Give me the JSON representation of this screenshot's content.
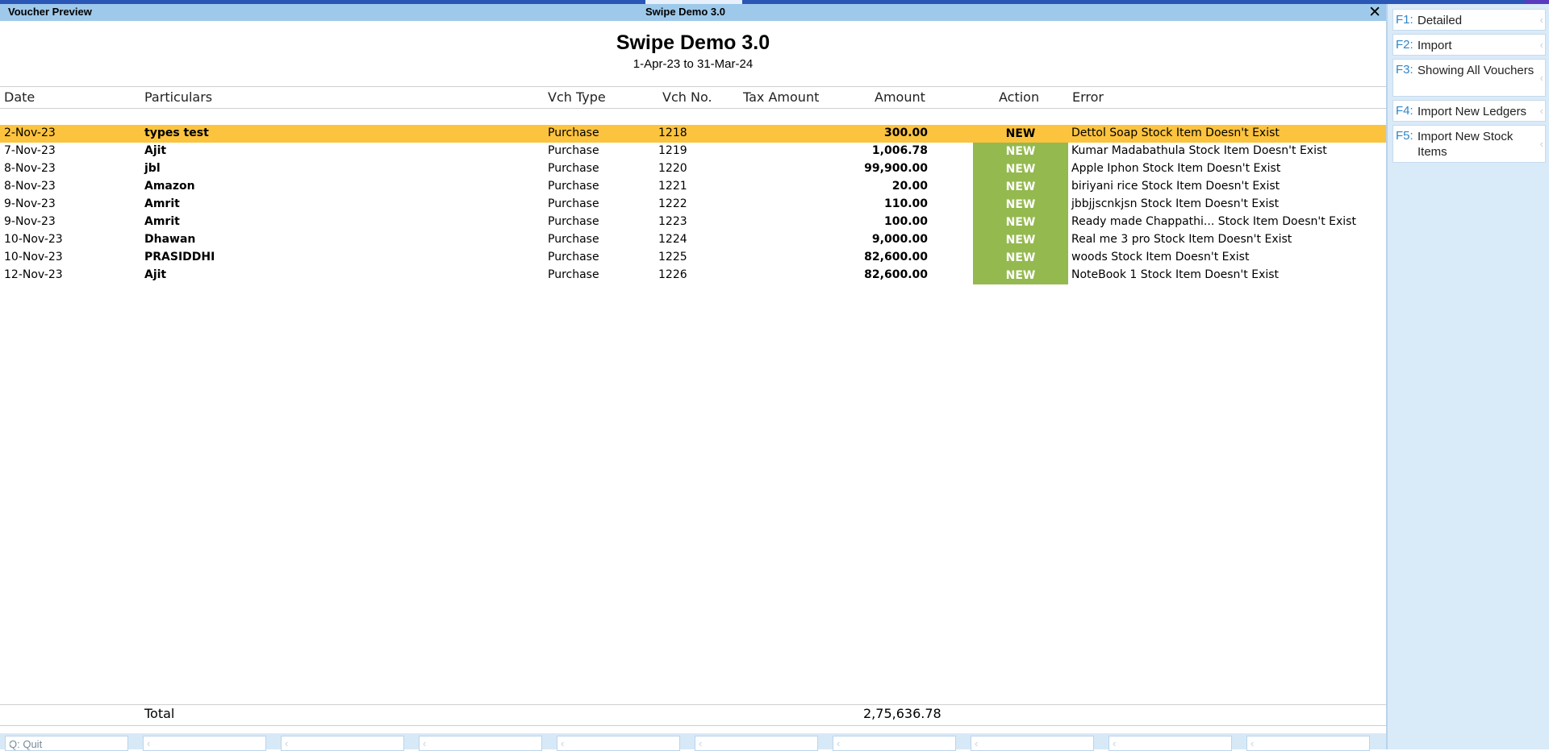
{
  "window": {
    "left_title": "Voucher Preview",
    "center_title": "Swipe Demo 3.0",
    "close_glyph": "✕"
  },
  "report": {
    "company": "Swipe Demo 3.0",
    "period": "1-Apr-23 to 31-Mar-24"
  },
  "columns": {
    "date": "Date",
    "particulars": "Particulars",
    "vch_type": "Vch Type",
    "vch_no": "Vch No.",
    "tax_amount": "Tax Amount",
    "amount": "Amount",
    "action": "Action",
    "error": "Error"
  },
  "rows": [
    {
      "date": "2-Nov-23",
      "particulars": "types test",
      "vch_type": "Purchase",
      "vch_no": "1218",
      "amount": "300.00",
      "action": "NEW",
      "error": "Dettol Soap Stock Item Doesn't Exist",
      "selected": true
    },
    {
      "date": "7-Nov-23",
      "particulars": "Ajit",
      "vch_type": "Purchase",
      "vch_no": "1219",
      "amount": "1,006.78",
      "action": "NEW",
      "error": "Kumar Madabathula Stock Item Doesn't Exist"
    },
    {
      "date": "8-Nov-23",
      "particulars": "jbl",
      "vch_type": "Purchase",
      "vch_no": "1220",
      "amount": "99,900.00",
      "action": "NEW",
      "error": "Apple Iphon Stock Item Doesn't Exist"
    },
    {
      "date": "8-Nov-23",
      "particulars": "Amazon",
      "vch_type": "Purchase",
      "vch_no": "1221",
      "amount": "20.00",
      "action": "NEW",
      "error": "biriyani rice Stock Item Doesn't Exist"
    },
    {
      "date": "9-Nov-23",
      "particulars": "Amrit",
      "vch_type": "Purchase",
      "vch_no": "1222",
      "amount": "110.00",
      "action": "NEW",
      "error": "jbbjjscnkjsn Stock Item Doesn't Exist"
    },
    {
      "date": "9-Nov-23",
      "particulars": "Amrit",
      "vch_type": "Purchase",
      "vch_no": "1223",
      "amount": "100.00",
      "action": "NEW",
      "error": "Ready made Chappathi... Stock Item Doesn't Exist"
    },
    {
      "date": "10-Nov-23",
      "particulars": "Dhawan",
      "vch_type": "Purchase",
      "vch_no": "1224",
      "amount": "9,000.00",
      "action": "NEW",
      "error": "Real me 3 pro Stock Item Doesn't Exist"
    },
    {
      "date": "10-Nov-23",
      "particulars": "PRASIDDHI",
      "vch_type": "Purchase",
      "vch_no": "1225",
      "amount": "82,600.00",
      "action": "NEW",
      "error": "woods Stock Item Doesn't Exist"
    },
    {
      "date": "12-Nov-23",
      "particulars": "Ajit",
      "vch_type": "Purchase",
      "vch_no": "1226",
      "amount": "82,600.00",
      "action": "NEW",
      "error": "NoteBook 1 Stock Item Doesn't Exist"
    }
  ],
  "totals": {
    "label": "Total",
    "amount": "2,75,636.78"
  },
  "bottom_buttons": [
    {
      "label": "Q: Quit"
    },
    {
      "label": ""
    },
    {
      "label": ""
    },
    {
      "label": ""
    },
    {
      "label": ""
    },
    {
      "label": ""
    },
    {
      "label": ""
    },
    {
      "label": ""
    },
    {
      "label": ""
    },
    {
      "label": ""
    }
  ],
  "sidebar": [
    {
      "key": "F1:",
      "label": "Detailed"
    },
    {
      "key": "F2:",
      "label": "Import"
    },
    {
      "key": "F3:",
      "label": "Showing All Vouchers"
    },
    {
      "key": "F4:",
      "label": "Import New Ledgers"
    },
    {
      "key": "F5:",
      "label": "Import New Stock Items"
    }
  ],
  "colors": {
    "selected_row": "#fcc33e",
    "action_badge": "#94b94f",
    "title_bar": "#9ec9ea",
    "sidebar_bg": "#d9eaf8",
    "function_key": "#2d86c8"
  }
}
